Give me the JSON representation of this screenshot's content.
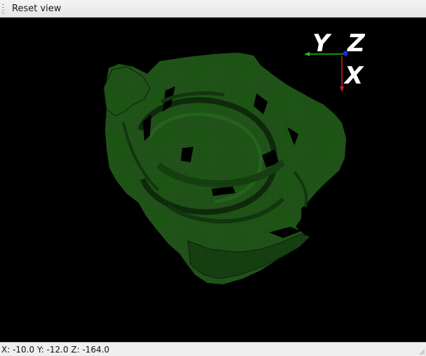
{
  "toolbar": {
    "reset_label": "Reset view"
  },
  "viewport": {
    "background": "#000000",
    "model_color": "#1b4a14",
    "axes": {
      "y_label": "Y",
      "z_label": "Z",
      "x_label": "X",
      "y_color": "#16c416",
      "x_color": "#d81a1a",
      "z_color": "#1a2cd8"
    }
  },
  "status": {
    "coords": "X: -10.0 Y: -12.0 Z: -164.0"
  }
}
